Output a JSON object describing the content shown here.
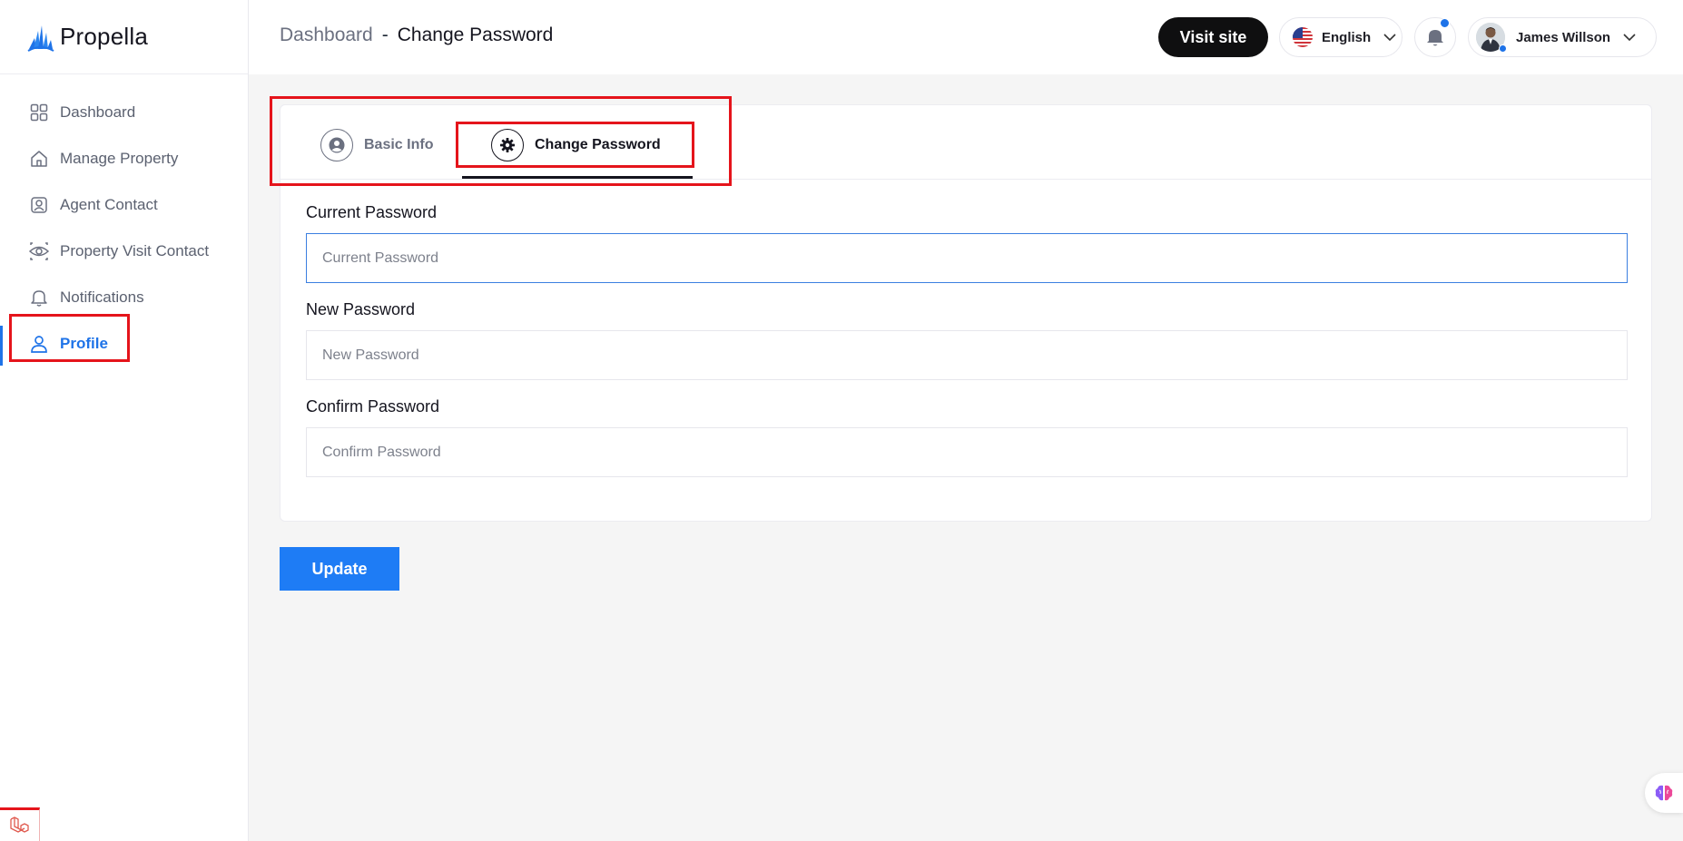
{
  "brand": {
    "name": "Propella"
  },
  "sidebar": {
    "items": [
      {
        "label": "Dashboard",
        "icon": "grid-icon"
      },
      {
        "label": "Manage Property",
        "icon": "home-icon"
      },
      {
        "label": "Agent Contact",
        "icon": "contact-icon"
      },
      {
        "label": "Property Visit Contact",
        "icon": "eye-icon"
      },
      {
        "label": "Notifications",
        "icon": "bell-icon"
      },
      {
        "label": "Profile",
        "icon": "user-icon",
        "active": true
      }
    ]
  },
  "header": {
    "breadcrumb_root": "Dashboard",
    "breadcrumb_sep": "-",
    "breadcrumb_current": "Change Password",
    "visit_site_label": "Visit site",
    "language_label": "English",
    "user_name": "James Willson"
  },
  "tabs": [
    {
      "label": "Basic Info",
      "icon": "user-circle-icon"
    },
    {
      "label": "Change Password",
      "icon": "gear-icon",
      "active": true
    }
  ],
  "form": {
    "current_password": {
      "label": "Current Password",
      "placeholder": "Current Password",
      "value": ""
    },
    "new_password": {
      "label": "New Password",
      "placeholder": "New Password",
      "value": ""
    },
    "confirm_password": {
      "label": "Confirm Password",
      "placeholder": "Confirm Password",
      "value": ""
    },
    "submit_label": "Update"
  },
  "colors": {
    "accent": "#1e73e8",
    "primary_button": "#1e7cf5",
    "highlight": "#e5141b"
  }
}
